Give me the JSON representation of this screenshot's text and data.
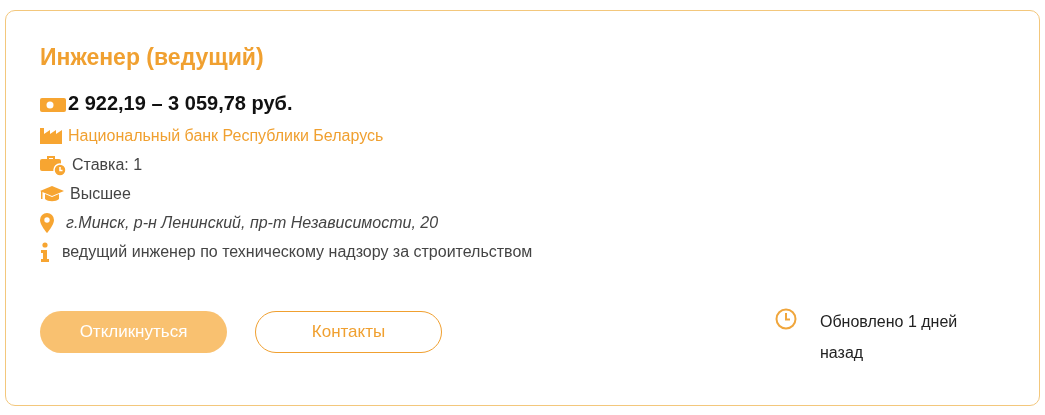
{
  "vacancy": {
    "title": "Инженер (ведущий)",
    "salary": "2 922,19 – 3 059,78 руб.",
    "details": [
      {
        "kind": "company",
        "text": "Национальный банк Республики Беларусь"
      },
      {
        "kind": "rate",
        "text": "Ставка: 1"
      },
      {
        "kind": "education",
        "text": "Высшее"
      },
      {
        "kind": "address",
        "text": "г.Минск, р-н Ленинский, пр-т Независимости, 20"
      },
      {
        "kind": "info",
        "text": "ведущий инженер по техническому надзору за строительством"
      }
    ],
    "buttons": [
      {
        "kind": "primary",
        "label": "Откликнуться"
      },
      {
        "kind": "outline",
        "label": "Контакты"
      }
    ],
    "updated": "Обновлено 1 дней назад"
  }
}
